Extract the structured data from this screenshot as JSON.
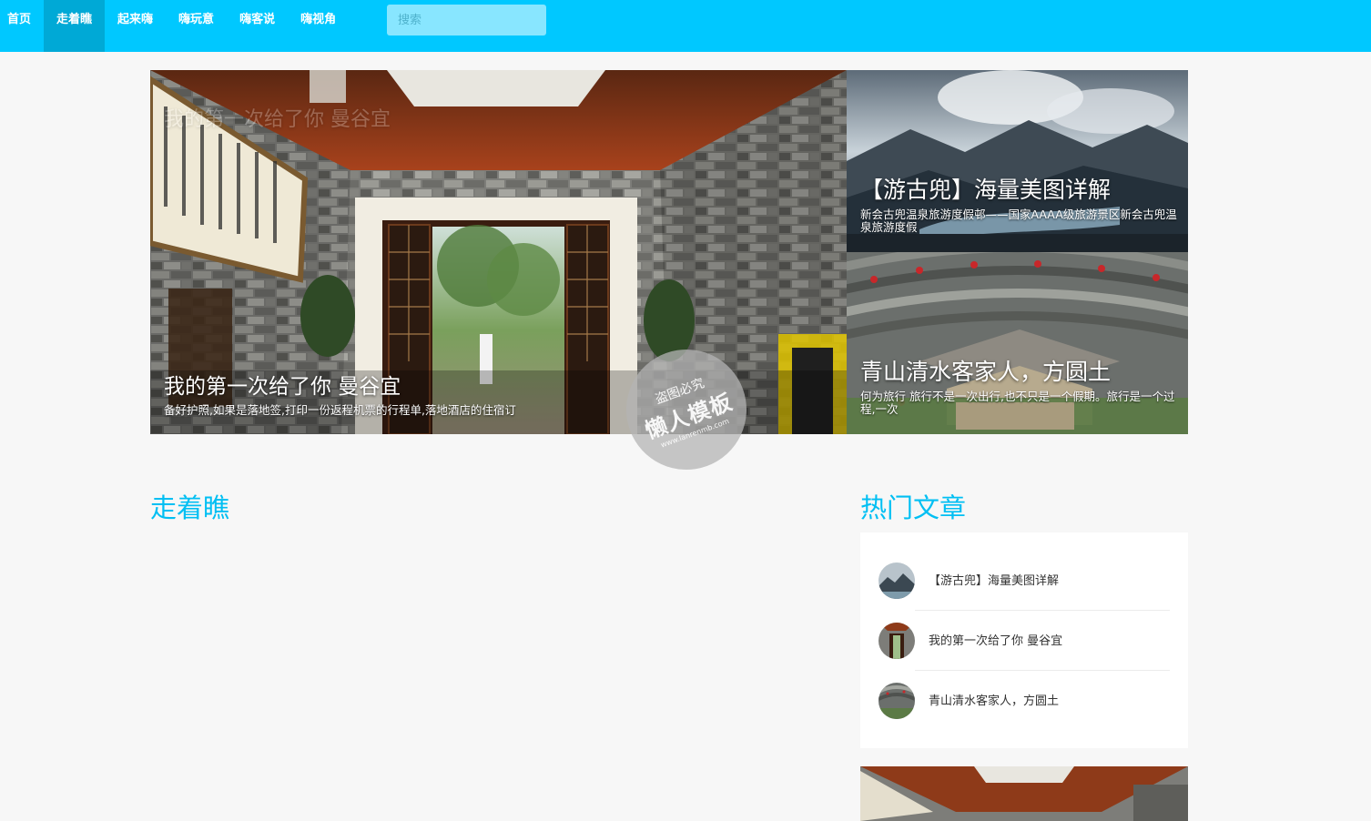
{
  "nav": {
    "items": [
      "首页",
      "走着瞧",
      "起来嗨",
      "嗨玩意",
      "嗨客说",
      "嗨视角"
    ],
    "active": "走着瞧",
    "search_placeholder": "搜索"
  },
  "hero": {
    "main": {
      "title": "我的第一次给了你 曼谷宜",
      "desc": "备好护照,如果是落地签,打印一份返程机票的行程单,落地酒店的住宿订",
      "faded_title": "我的第一次给了你 曼谷宜"
    },
    "side": [
      {
        "title": "【游古兜】海量美图详解",
        "desc": "新会古兜温泉旅游度假邨——国家AAAA级旅游景区新会古兜温泉旅游度假"
      },
      {
        "title": "青山清水客家人，方圆土",
        "desc": "何为旅行 旅行不是一次出行,也不只是一个假期。旅行是一个过程,一次"
      }
    ],
    "watermark": {
      "line1": "盗图必究",
      "line2": "懒人模板",
      "line3": "www.lanrenmb.com"
    }
  },
  "sections": {
    "main_title": "走着瞧",
    "hot_title": "热门文章"
  },
  "hot_articles": [
    {
      "title": "【游古兜】海量美图详解",
      "thumb_icon": "mountain-thumb-icon"
    },
    {
      "title": "我的第一次给了你 曼谷宜",
      "thumb_icon": "hall-thumb-icon"
    },
    {
      "title": "青山清水客家人，方圆土",
      "thumb_icon": "tulou-thumb-icon"
    }
  ],
  "colors": {
    "accent": "#00c8ff",
    "nav_active": "#00a9d6",
    "heading": "#00bff3",
    "background": "#f7f7f7"
  }
}
